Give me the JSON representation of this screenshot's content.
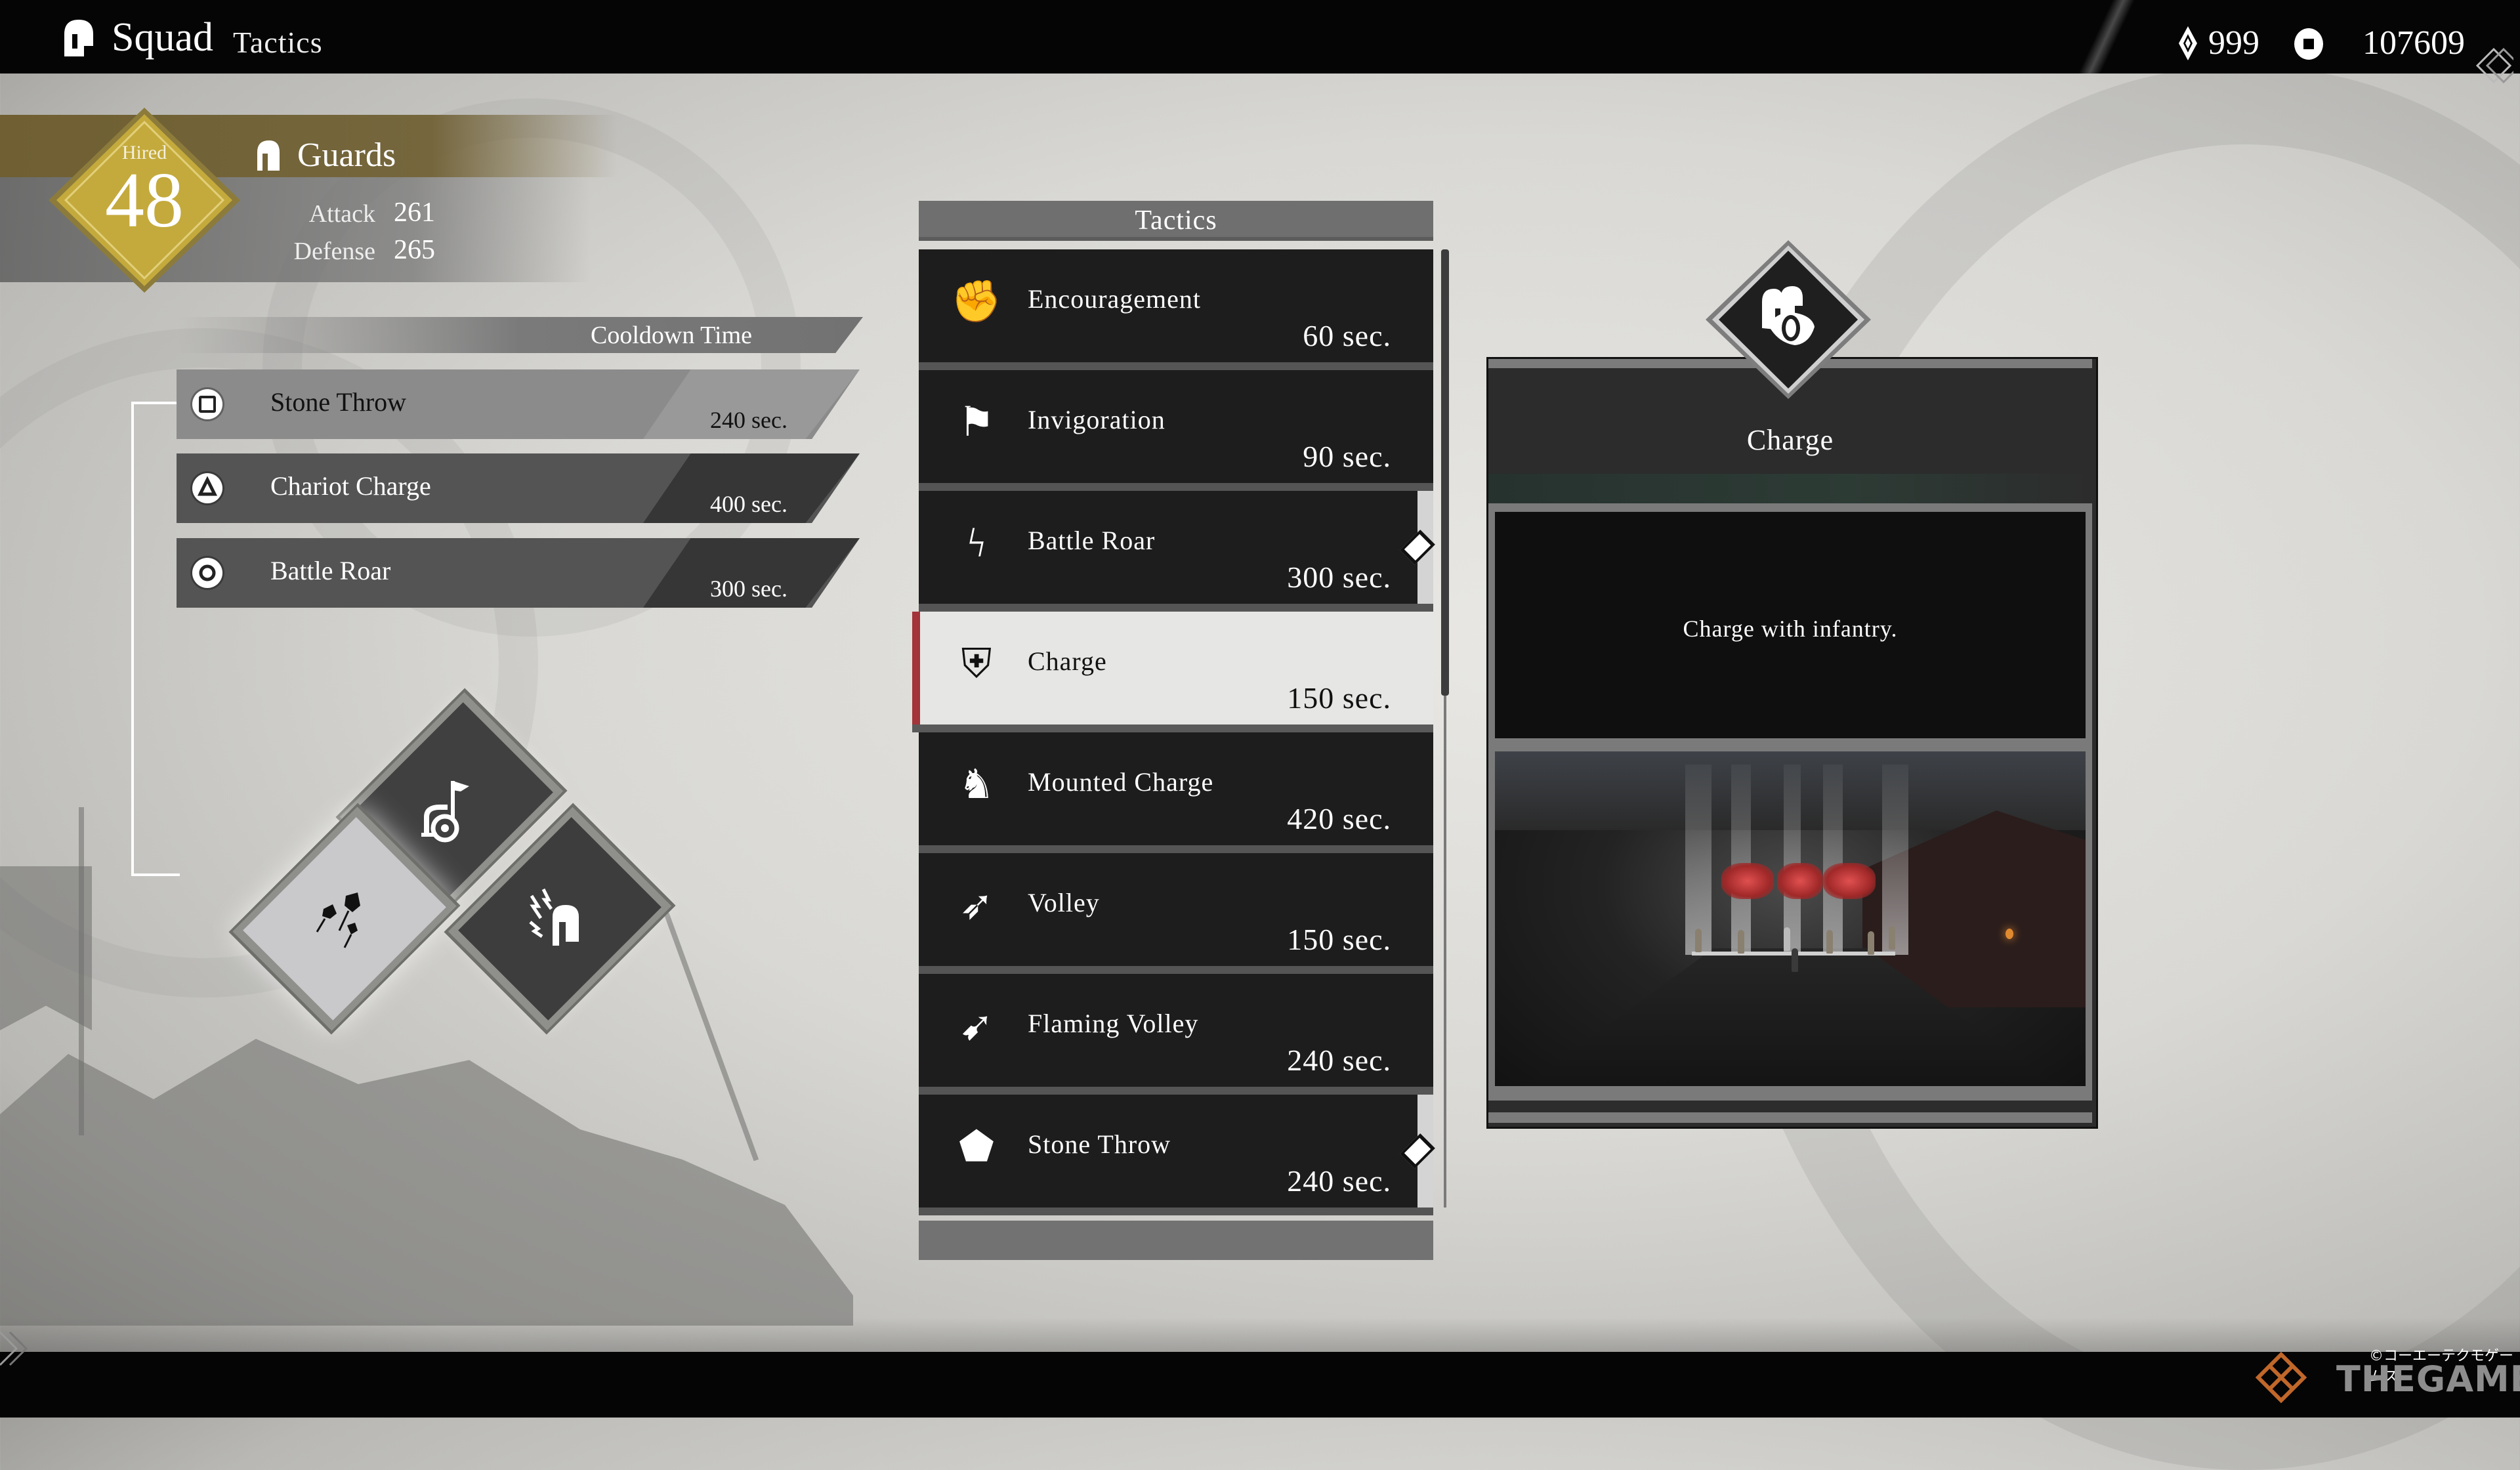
{
  "header": {
    "title": "Squad",
    "subtitle": "Tactics",
    "title_icon": "helmet-icon",
    "currencies": [
      {
        "icon": "gem-icon",
        "value": "999"
      },
      {
        "icon": "coin-icon",
        "value": "107609"
      }
    ]
  },
  "unit": {
    "hired_label": "Hired",
    "hired_count": "48",
    "icon": "helmet-icon",
    "name": "Guards",
    "stats": [
      {
        "label": "Attack",
        "value": "261"
      },
      {
        "label": "Defense",
        "value": "265"
      }
    ]
  },
  "equipped": {
    "header": "Cooldown Time",
    "items": [
      {
        "button": "square",
        "name": "Stone Throw",
        "time": "240 sec.",
        "highlighted": true
      },
      {
        "button": "triangle",
        "name": "Chariot Charge",
        "time": "400 sec.",
        "highlighted": false
      },
      {
        "button": "circle",
        "name": "Battle Roar",
        "time": "300 sec.",
        "highlighted": false
      }
    ],
    "slots": [
      {
        "position": "top",
        "icon": "chariot-icon",
        "tactic": "Chariot Charge"
      },
      {
        "position": "left",
        "icon": "stone-throw-icon",
        "tactic": "Stone Throw",
        "selected": true
      },
      {
        "position": "right",
        "icon": "battle-roar-icon",
        "tactic": "Battle Roar"
      }
    ]
  },
  "tactics": {
    "header": "Tactics",
    "items": [
      {
        "icon": "encouragement-icon",
        "glyph": "✊",
        "name": "Encouragement",
        "time": "60 sec.",
        "assigned": false,
        "selected": false
      },
      {
        "icon": "invigoration-icon",
        "glyph": "⚑",
        "name": "Invigoration",
        "time": "90 sec.",
        "assigned": false,
        "selected": false
      },
      {
        "icon": "battle-roar-icon",
        "glyph": "ϟ",
        "name": "Battle Roar",
        "time": "300 sec.",
        "assigned": true,
        "selected": false
      },
      {
        "icon": "charge-icon",
        "glyph": "⛨",
        "name": "Charge",
        "time": "150 sec.",
        "assigned": false,
        "selected": true
      },
      {
        "icon": "mounted-charge-icon",
        "glyph": "♞",
        "name": "Mounted Charge",
        "time": "420 sec.",
        "assigned": false,
        "selected": false
      },
      {
        "icon": "volley-icon",
        "glyph": "➶",
        "name": "Volley",
        "time": "150 sec.",
        "assigned": false,
        "selected": false
      },
      {
        "icon": "flaming-volley-icon",
        "glyph": "➹",
        "name": "Flaming Volley",
        "time": "240 sec.",
        "assigned": false,
        "selected": false
      },
      {
        "icon": "stone-throw-icon",
        "glyph": "⬟",
        "name": "Stone Throw",
        "time": "240 sec.",
        "assigned": true,
        "selected": false
      }
    ]
  },
  "detail": {
    "icon": "charge-icon",
    "glyph": "⛨",
    "title": "Charge",
    "description": "Charge with infantry."
  },
  "footer": {
    "copyright": "©コーエーテクモゲームス",
    "watermark": "THEGAMER"
  },
  "colors": {
    "selected_accent": "#a2343a",
    "hired_gold": "#c2a83a",
    "unit_banner": "#6f5f32",
    "watermark_orange": "#c0672a"
  }
}
